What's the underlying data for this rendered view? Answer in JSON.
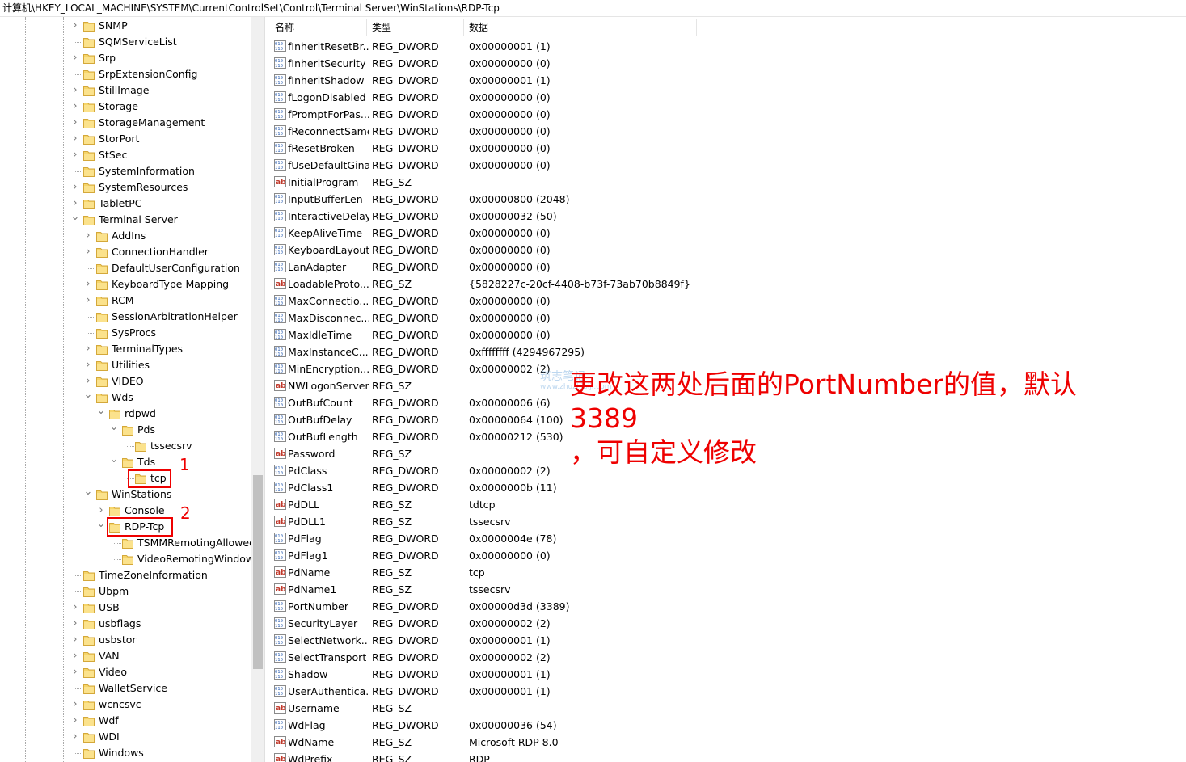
{
  "address_path": "计算机\\HKEY_LOCAL_MACHINE\\SYSTEM\\CurrentControlSet\\Control\\Terminal Server\\WinStations\\RDP-Tcp",
  "colors": {
    "folder": "#f6d56a",
    "annotation": "#ee0000",
    "selection_box": "#ee0000"
  },
  "tree": [
    {
      "label": "SNMP",
      "level": 0,
      "expander": "collapsed"
    },
    {
      "label": "SQMServiceList",
      "level": 0,
      "expander": "none"
    },
    {
      "label": "Srp",
      "level": 0,
      "expander": "collapsed"
    },
    {
      "label": "SrpExtensionConfig",
      "level": 0,
      "expander": "none"
    },
    {
      "label": "StillImage",
      "level": 0,
      "expander": "collapsed"
    },
    {
      "label": "Storage",
      "level": 0,
      "expander": "collapsed"
    },
    {
      "label": "StorageManagement",
      "level": 0,
      "expander": "collapsed"
    },
    {
      "label": "StorPort",
      "level": 0,
      "expander": "collapsed"
    },
    {
      "label": "StSec",
      "level": 0,
      "expander": "collapsed"
    },
    {
      "label": "SystemInformation",
      "level": 0,
      "expander": "none"
    },
    {
      "label": "SystemResources",
      "level": 0,
      "expander": "collapsed"
    },
    {
      "label": "TabletPC",
      "level": 0,
      "expander": "collapsed"
    },
    {
      "label": "Terminal Server",
      "level": 0,
      "expander": "expanded"
    },
    {
      "label": "AddIns",
      "level": 1,
      "expander": "collapsed"
    },
    {
      "label": "ConnectionHandler",
      "level": 1,
      "expander": "collapsed"
    },
    {
      "label": "DefaultUserConfiguration",
      "level": 1,
      "expander": "none"
    },
    {
      "label": "KeyboardType Mapping",
      "level": 1,
      "expander": "collapsed"
    },
    {
      "label": "RCM",
      "level": 1,
      "expander": "collapsed"
    },
    {
      "label": "SessionArbitrationHelper",
      "level": 1,
      "expander": "none"
    },
    {
      "label": "SysProcs",
      "level": 1,
      "expander": "none"
    },
    {
      "label": "TerminalTypes",
      "level": 1,
      "expander": "collapsed"
    },
    {
      "label": "Utilities",
      "level": 1,
      "expander": "collapsed"
    },
    {
      "label": "VIDEO",
      "level": 1,
      "expander": "collapsed"
    },
    {
      "label": "Wds",
      "level": 1,
      "expander": "expanded"
    },
    {
      "label": "rdpwd",
      "level": 2,
      "expander": "expanded"
    },
    {
      "label": "Pds",
      "level": 3,
      "expander": "expanded"
    },
    {
      "label": "tssecsrv",
      "level": 4,
      "expander": "none"
    },
    {
      "label": "Tds",
      "level": 3,
      "expander": "expanded"
    },
    {
      "label": "tcp",
      "level": 4,
      "expander": "none"
    },
    {
      "label": "WinStations",
      "level": 1,
      "expander": "expanded"
    },
    {
      "label": "Console",
      "level": 2,
      "expander": "collapsed"
    },
    {
      "label": "RDP-Tcp",
      "level": 2,
      "expander": "expanded"
    },
    {
      "label": "TSMMRemotingAllowed",
      "level": 3,
      "expander": "none"
    },
    {
      "label": "VideoRemotingWindowI",
      "level": 3,
      "expander": "none"
    },
    {
      "label": "TimeZoneInformation",
      "level": 0,
      "expander": "none"
    },
    {
      "label": "Ubpm",
      "level": 0,
      "expander": "none"
    },
    {
      "label": "USB",
      "level": 0,
      "expander": "collapsed"
    },
    {
      "label": "usbflags",
      "level": 0,
      "expander": "collapsed"
    },
    {
      "label": "usbstor",
      "level": 0,
      "expander": "collapsed"
    },
    {
      "label": "VAN",
      "level": 0,
      "expander": "collapsed"
    },
    {
      "label": "Video",
      "level": 0,
      "expander": "collapsed"
    },
    {
      "label": "WalletService",
      "level": 0,
      "expander": "none"
    },
    {
      "label": "wcncsvc",
      "level": 0,
      "expander": "collapsed"
    },
    {
      "label": "Wdf",
      "level": 0,
      "expander": "collapsed"
    },
    {
      "label": "WDI",
      "level": 0,
      "expander": "collapsed"
    },
    {
      "label": "Windows",
      "level": 0,
      "expander": "none"
    }
  ],
  "columns": {
    "name": "名称",
    "type": "类型",
    "data": "数据"
  },
  "values": [
    {
      "name": "fInheritResetBr...",
      "type": "REG_DWORD",
      "data": "0x00000001 (1)",
      "icon": "dword-icon"
    },
    {
      "name": "fInheritSecurity",
      "type": "REG_DWORD",
      "data": "0x00000000 (0)",
      "icon": "dword-icon"
    },
    {
      "name": "fInheritShadow",
      "type": "REG_DWORD",
      "data": "0x00000001 (1)",
      "icon": "dword-icon"
    },
    {
      "name": "fLogonDisabled",
      "type": "REG_DWORD",
      "data": "0x00000000 (0)",
      "icon": "dword-icon"
    },
    {
      "name": "fPromptForPas...",
      "type": "REG_DWORD",
      "data": "0x00000000 (0)",
      "icon": "dword-icon"
    },
    {
      "name": "fReconnectSame",
      "type": "REG_DWORD",
      "data": "0x00000000 (0)",
      "icon": "dword-icon"
    },
    {
      "name": "fResetBroken",
      "type": "REG_DWORD",
      "data": "0x00000000 (0)",
      "icon": "dword-icon"
    },
    {
      "name": "fUseDefaultGina",
      "type": "REG_DWORD",
      "data": "0x00000000 (0)",
      "icon": "dword-icon"
    },
    {
      "name": "InitialProgram",
      "type": "REG_SZ",
      "data": "",
      "icon": "string-icon"
    },
    {
      "name": "InputBufferLen",
      "type": "REG_DWORD",
      "data": "0x00000800 (2048)",
      "icon": "dword-icon"
    },
    {
      "name": "InteractiveDelay",
      "type": "REG_DWORD",
      "data": "0x00000032 (50)",
      "icon": "dword-icon"
    },
    {
      "name": "KeepAliveTime",
      "type": "REG_DWORD",
      "data": "0x00000000 (0)",
      "icon": "dword-icon"
    },
    {
      "name": "KeyboardLayout",
      "type": "REG_DWORD",
      "data": "0x00000000 (0)",
      "icon": "dword-icon"
    },
    {
      "name": "LanAdapter",
      "type": "REG_DWORD",
      "data": "0x00000000 (0)",
      "icon": "dword-icon"
    },
    {
      "name": "LoadableProto...",
      "type": "REG_SZ",
      "data": "{5828227c-20cf-4408-b73f-73ab70b8849f}",
      "icon": "string-icon"
    },
    {
      "name": "MaxConnectio...",
      "type": "REG_DWORD",
      "data": "0x00000000 (0)",
      "icon": "dword-icon"
    },
    {
      "name": "MaxDisconnec...",
      "type": "REG_DWORD",
      "data": "0x00000000 (0)",
      "icon": "dword-icon"
    },
    {
      "name": "MaxIdleTime",
      "type": "REG_DWORD",
      "data": "0x00000000 (0)",
      "icon": "dword-icon"
    },
    {
      "name": "MaxInstanceC...",
      "type": "REG_DWORD",
      "data": "0xffffffff (4294967295)",
      "icon": "dword-icon"
    },
    {
      "name": "MinEncryption...",
      "type": "REG_DWORD",
      "data": "0x00000002 (2)",
      "icon": "dword-icon"
    },
    {
      "name": "NWLogonServer",
      "type": "REG_SZ",
      "data": "",
      "icon": "string-icon"
    },
    {
      "name": "OutBufCount",
      "type": "REG_DWORD",
      "data": "0x00000006 (6)",
      "icon": "dword-icon"
    },
    {
      "name": "OutBufDelay",
      "type": "REG_DWORD",
      "data": "0x00000064 (100)",
      "icon": "dword-icon"
    },
    {
      "name": "OutBufLength",
      "type": "REG_DWORD",
      "data": "0x00000212 (530)",
      "icon": "dword-icon"
    },
    {
      "name": "Password",
      "type": "REG_SZ",
      "data": "",
      "icon": "string-icon"
    },
    {
      "name": "PdClass",
      "type": "REG_DWORD",
      "data": "0x00000002 (2)",
      "icon": "dword-icon"
    },
    {
      "name": "PdClass1",
      "type": "REG_DWORD",
      "data": "0x0000000b (11)",
      "icon": "dword-icon"
    },
    {
      "name": "PdDLL",
      "type": "REG_SZ",
      "data": "tdtcp",
      "icon": "string-icon"
    },
    {
      "name": "PdDLL1",
      "type": "REG_SZ",
      "data": "tssecsrv",
      "icon": "string-icon"
    },
    {
      "name": "PdFlag",
      "type": "REG_DWORD",
      "data": "0x0000004e (78)",
      "icon": "dword-icon"
    },
    {
      "name": "PdFlag1",
      "type": "REG_DWORD",
      "data": "0x00000000 (0)",
      "icon": "dword-icon"
    },
    {
      "name": "PdName",
      "type": "REG_SZ",
      "data": "tcp",
      "icon": "string-icon"
    },
    {
      "name": "PdName1",
      "type": "REG_SZ",
      "data": "tssecsrv",
      "icon": "string-icon"
    },
    {
      "name": "PortNumber",
      "type": "REG_DWORD",
      "data": "0x00000d3d (3389)",
      "icon": "dword-icon"
    },
    {
      "name": "SecurityLayer",
      "type": "REG_DWORD",
      "data": "0x00000002 (2)",
      "icon": "dword-icon"
    },
    {
      "name": "SelectNetwork...",
      "type": "REG_DWORD",
      "data": "0x00000001 (1)",
      "icon": "dword-icon"
    },
    {
      "name": "SelectTransport",
      "type": "REG_DWORD",
      "data": "0x00000002 (2)",
      "icon": "dword-icon"
    },
    {
      "name": "Shadow",
      "type": "REG_DWORD",
      "data": "0x00000001 (1)",
      "icon": "dword-icon"
    },
    {
      "name": "UserAuthentica...",
      "type": "REG_DWORD",
      "data": "0x00000001 (1)",
      "icon": "dword-icon"
    },
    {
      "name": "Username",
      "type": "REG_SZ",
      "data": "",
      "icon": "string-icon"
    },
    {
      "name": "WdFlag",
      "type": "REG_DWORD",
      "data": "0x00000036 (54)",
      "icon": "dword-icon"
    },
    {
      "name": "WdName",
      "type": "REG_SZ",
      "data": "Microsoft RDP 8.0",
      "icon": "string-icon"
    },
    {
      "name": "WdPrefix",
      "type": "REG_SZ",
      "data": "RDP",
      "icon": "string-icon"
    }
  ],
  "annotation": {
    "marker1": "1",
    "marker2": "2",
    "text_line1": "更改这两处后面的PortNumber的值，默认3389",
    "text_line2": "，可自定义修改"
  },
  "watermark": {
    "line1": "筑志笔记",
    "line2": "www.zhuzhibiji.com"
  }
}
